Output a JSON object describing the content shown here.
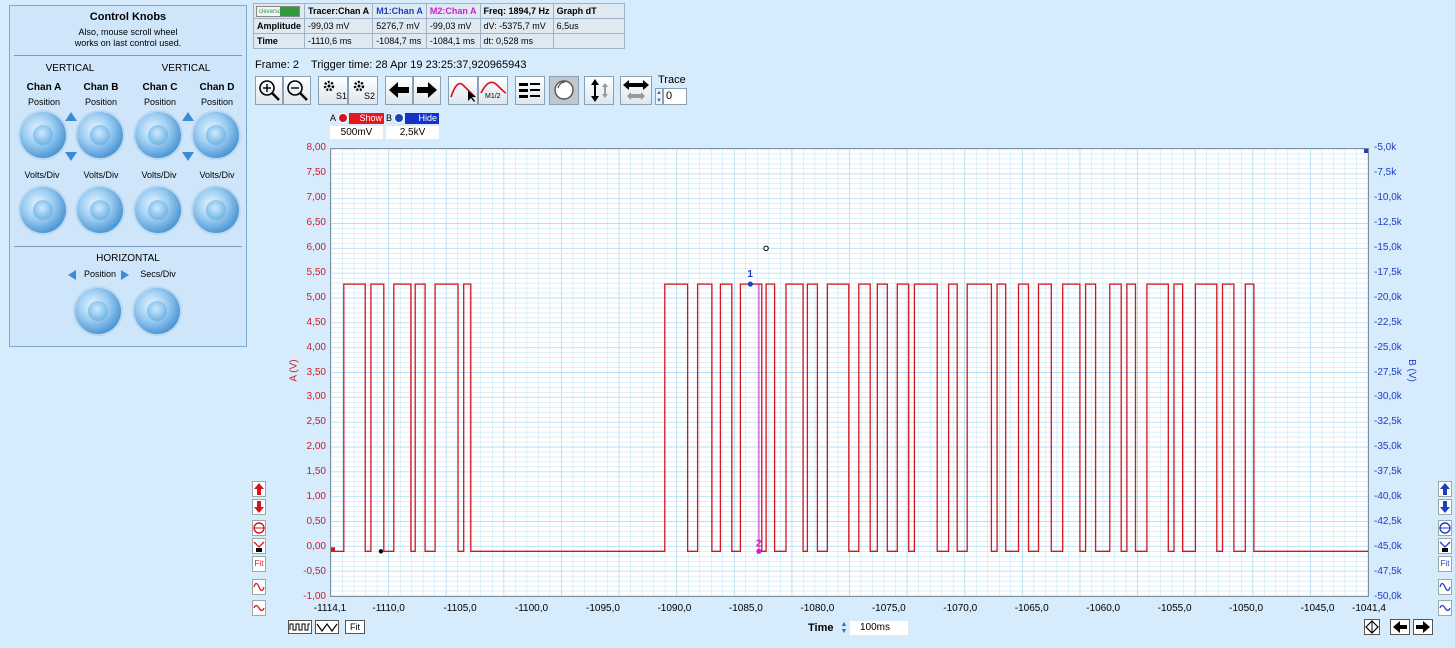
{
  "knobs": {
    "title": "Control Knobs",
    "subtitle_1": "Also, mouse scroll wheel",
    "subtitle_2": "works on last control used.",
    "vertical_left": "VERTICAL",
    "vertical_right": "VERTICAL",
    "chan_a": "Chan A",
    "chan_b": "Chan B",
    "chan_c": "Chan C",
    "chan_d": "Chan D",
    "position": "Position",
    "volts_div": "Volts/Div",
    "horizontal": "HORIZONTAL",
    "secs_div": "Secs/Div"
  },
  "measurements": {
    "logo": "cleverscope",
    "headers": [
      "Tracer:Chan A",
      "M1:Chan A",
      "M2:Chan A",
      "Freq: 1894,7 Hz",
      "Graph dT"
    ],
    "rows": [
      {
        "label": "Amplitude",
        "cells": [
          "-99,03 mV",
          "5276,7 mV",
          "-99,03 mV",
          "dV: -5375,7 mV",
          "6,5us"
        ]
      },
      {
        "label": "Time",
        "cells": [
          "-1110,6 ms",
          "-1084,7 ms",
          "-1084,1 ms",
          "dt:  0,528 ms",
          ""
        ]
      }
    ]
  },
  "frame": {
    "text": "Frame: 2    Trigger time: 28 Apr 19 23:25:37,920965943"
  },
  "toolbar": {
    "s1": "S1",
    "s2": "S2",
    "m12": "M1/2",
    "trace_label": "Trace",
    "trace_value": "0"
  },
  "channels": {
    "a_letter": "A",
    "a_btn": "Show",
    "a_scale": "500mV",
    "b_letter": "B",
    "b_btn": "Hide",
    "b_scale": "2,5kV"
  },
  "axes": {
    "left_title": "A (V)",
    "right_title": "B (V)",
    "left_ticks": [
      "8,00",
      "7,50",
      "7,00",
      "6,50",
      "6,00",
      "5,50",
      "5,00",
      "4,50",
      "4,00",
      "3,50",
      "3,00",
      "2,50",
      "2,00",
      "1,50",
      "1,00",
      "0,50",
      "0,00",
      "-0,50",
      "-1,00"
    ],
    "right_ticks": [
      "-5,0k",
      "-7,5k",
      "-10,0k",
      "-12,5k",
      "-15,0k",
      "-17,5k",
      "-20,0k",
      "-22,5k",
      "-25,0k",
      "-27,5k",
      "-30,0k",
      "-32,5k",
      "-35,0k",
      "-37,5k",
      "-40,0k",
      "-42,5k",
      "-45,0k",
      "-47,5k",
      "-50,0k"
    ],
    "x_ticks": [
      "-1114,1",
      "-1110,0",
      "-1105,0",
      "-1100,0",
      "-1095,0",
      "-1090,0",
      "-1085,0",
      "-1080,0",
      "-1075,0",
      "-1070,0",
      "-1065,0",
      "-1060,0",
      "-1055,0",
      "-1050,0",
      "-1045,0",
      "-1041,4"
    ],
    "time_label": "Time",
    "time_per_div": "100ms",
    "fit": "Fit"
  },
  "markers": {
    "m1": "1",
    "m2": "2"
  },
  "colors": {
    "trace": "#d4141e",
    "grid": "#b7def0",
    "left_axis": "#cc1b2a",
    "right_axis": "#1f3fbf"
  }
}
